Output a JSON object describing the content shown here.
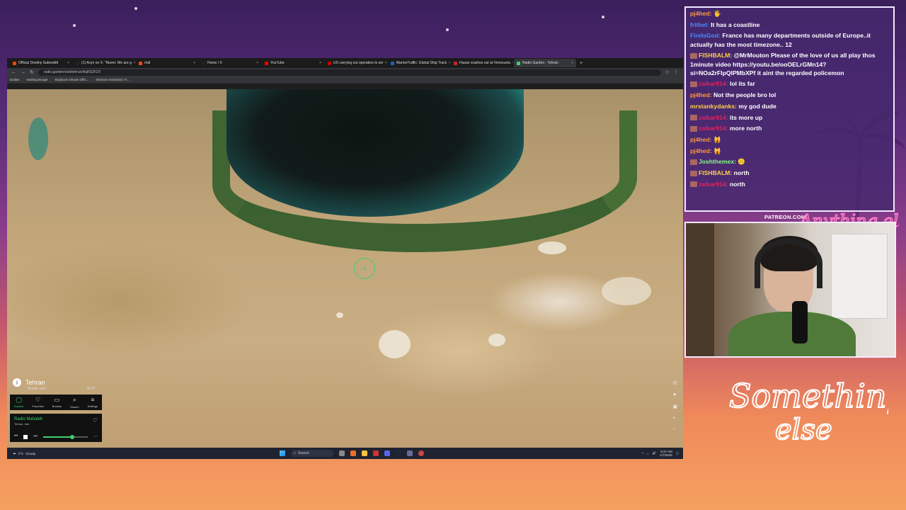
{
  "browser": {
    "tabs": [
      {
        "label": "Official Destiny Subreddit",
        "color": "#ff4500"
      },
      {
        "label": "(1) Acyn on X: \"Noem: We are g",
        "color": "#222"
      },
      {
        "label": "r/all",
        "color": "#ff4500"
      },
      {
        "label": "Home / X",
        "color": "#222"
      },
      {
        "label": "YouTube",
        "color": "#ff0000"
      },
      {
        "label": "US carrying out operation to sei",
        "color": "#cc0000"
      },
      {
        "label": "MarineTraffic: Global Ship Track",
        "color": "#1565c0"
      },
      {
        "label": "Hasan crashes out at Venezuela",
        "color": "#c62828"
      },
      {
        "label": "Radio Garden - Tehran",
        "color": "#3dd16e"
      }
    ],
    "url": "radio.garden/visit/tehran/AqRS2FZX",
    "bookmarks": [
      "Dailies",
      "Nothing Burger",
      "Bodycam Shows Offic...",
      "Electron Anticheat | Tr..."
    ]
  },
  "radio_garden": {
    "city": "Tehran",
    "city_sub": "Tehran, Iran",
    "local_time": "18:37",
    "nav": [
      {
        "label": "Explore",
        "icon": "◯"
      },
      {
        "label": "Favorites",
        "icon": "♡"
      },
      {
        "label": "Browse",
        "icon": "▭"
      },
      {
        "label": "Search",
        "icon": "⌕"
      },
      {
        "label": "Settings",
        "icon": "≡"
      }
    ],
    "station": "Radio Mahaleh",
    "station_sub": "Tehran, Iran",
    "volume": 0.65
  },
  "taskbar": {
    "temp": "2°C",
    "weather": "Cloudy",
    "search": "Search",
    "time": "8:37 AM",
    "date": "1/7/2026"
  },
  "chat": [
    {
      "user": "pj4hed:",
      "color": "#ff9a3c",
      "text": "🖐",
      "badge": false
    },
    {
      "user": "frithel:",
      "color": "#4a8cff",
      "text": "It has a coastline",
      "badge": false
    },
    {
      "user": "FireIsGod:",
      "color": "#4a8cff",
      "text": "France has many departments outside of Europe..it actually has the most timezone.. 12",
      "badge": false
    },
    {
      "user": "FISHBALM:",
      "color": "#ffd24a",
      "text": "@MrMouton Please of the love of us all play thos 1minute video https://youtu.be/ooOELrGMn14?si=NOa2rFlpQIPMbXPf it aint the regarded policemon",
      "badge": true
    },
    {
      "user": "zalkar914:",
      "color": "#e0245e",
      "text": "lol its far",
      "badge": true
    },
    {
      "user": "pj4hed:",
      "color": "#ff9a3c",
      "text": "Not the people bro lol",
      "badge": false
    },
    {
      "user": "mrstankydanks:",
      "color": "#ffd24a",
      "text": "my god dude",
      "badge": false
    },
    {
      "user": "zalkar914:",
      "color": "#e0245e",
      "text": "its more up",
      "badge": true
    },
    {
      "user": "zalkar914:",
      "color": "#e0245e",
      "text": "more north",
      "badge": true
    },
    {
      "user": "pj4hed:",
      "color": "#ff9a3c",
      "text": "🙀",
      "badge": false
    },
    {
      "user": "pj4hed:",
      "color": "#ff9a3c",
      "text": "🙀",
      "badge": false
    },
    {
      "user": "Joshthemex:",
      "color": "#7fff7f",
      "text": "🙃",
      "badge": true
    },
    {
      "user": "FISHBALM:",
      "color": "#ffd24a",
      "text": "north",
      "badge": true
    },
    {
      "user": "zalkar914:",
      "color": "#e0245e",
      "text": "north",
      "badge": true
    }
  ],
  "overlay": {
    "patreon": "PATREON.COM/",
    "brand_top": "Anything else",
    "brand_bottom_1": "Something",
    "brand_bottom_2": "else"
  }
}
